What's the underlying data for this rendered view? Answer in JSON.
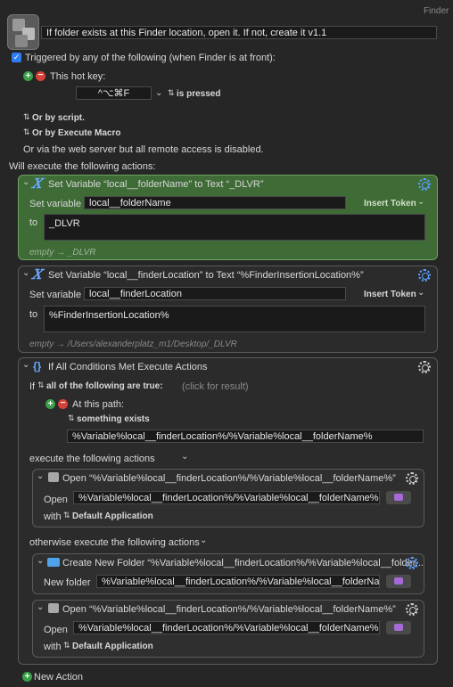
{
  "top_right": "Finder",
  "macro_title": "If folder exists at this Finder location, open it. If not, create it v1.1",
  "trigger": {
    "checkbox_label": "Triggered by any of the following (when Finder is at front):",
    "hotkey_label": "This hot key:",
    "hotkey_value": "^⌥⌘F",
    "hotkey_mode": "is pressed",
    "or_script": "Or by script.",
    "or_execute": "Or by Execute Macro",
    "or_web": "Or via the web server but all remote access is disabled."
  },
  "will_execute": "Will execute the following actions:",
  "action1": {
    "title": "Set Variable “local__folderName” to Text “_DLVR”",
    "set_var_label": "Set variable",
    "var_name": "local__folderName",
    "insert_token": "Insert Token",
    "to_label": "to",
    "value": "_DLVR",
    "preview": "empty → _DLVR"
  },
  "action2": {
    "title": "Set Variable “local__finderLocation” to Text “%FinderInsertionLocation%”",
    "set_var_label": "Set variable",
    "var_name": "local__finderLocation",
    "insert_token": "Insert Token",
    "to_label": "to",
    "value": "%FinderInsertionLocation%",
    "preview": "empty → /Users/alexanderplatz_m1/Desktop/_DLVR"
  },
  "action3": {
    "title": "If All Conditions Met Execute Actions",
    "if_label": "If",
    "all_label": "all of the following are true:",
    "click_result": "(click for result)",
    "at_path_label": "At this path:",
    "something_exists": "something exists",
    "path_value": "%Variable%local__finderLocation%/%Variable%local__folderName%",
    "execute_label": "execute the following actions",
    "otherwise_label": "otherwise execute the following actions",
    "open1": {
      "title": "Open “%Variable%local__finderLocation%/%Variable%local__folderName%”",
      "open_label": "Open",
      "path": "%Variable%local__finderLocation%/%Variable%local__folderName%",
      "with_label": "with",
      "app": "Default Application"
    },
    "create": {
      "title": "Create New Folder “%Variable%local__finderLocation%/%Variable%local__folder...",
      "label": "New folder",
      "path": "%Variable%local__finderLocation%/%Variable%local__folderName%"
    },
    "open2": {
      "title": "Open “%Variable%local__finderLocation%/%Variable%local__folderName%”",
      "open_label": "Open",
      "path": "%Variable%local__finderLocation%/%Variable%local__folderName%",
      "with_label": "with",
      "app": "Default Application"
    }
  },
  "new_action": "New Action"
}
